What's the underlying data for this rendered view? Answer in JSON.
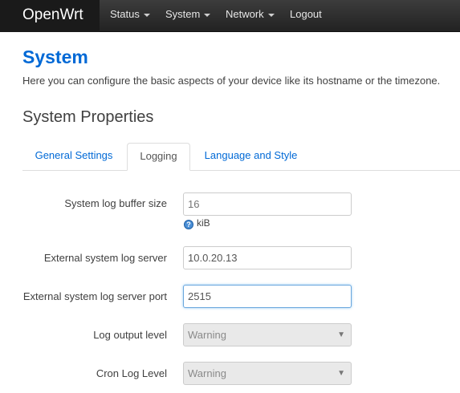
{
  "navbar": {
    "brand": "OpenWrt",
    "items": [
      {
        "label": "Status",
        "dropdown": true
      },
      {
        "label": "System",
        "dropdown": true
      },
      {
        "label": "Network",
        "dropdown": true
      },
      {
        "label": "Logout",
        "dropdown": false
      }
    ]
  },
  "page": {
    "title": "System",
    "description": "Here you can configure the basic aspects of your device like its hostname or the timezone.",
    "section_title": "System Properties"
  },
  "tabs": [
    {
      "label": "General Settings",
      "active": false
    },
    {
      "label": "Logging",
      "active": true
    },
    {
      "label": "Language and Style",
      "active": false
    }
  ],
  "form": {
    "log_buffer_size": {
      "label": "System log buffer size",
      "value": "",
      "placeholder": "16",
      "hint": "kiB"
    },
    "log_server": {
      "label": "External system log server",
      "value": "10.0.20.13"
    },
    "log_server_port": {
      "label": "External system log server port",
      "value": "2515"
    },
    "log_output_level": {
      "label": "Log output level",
      "selected": "Warning"
    },
    "cron_log_level": {
      "label": "Cron Log Level",
      "selected": "Warning"
    }
  },
  "colors": {
    "accent": "#0069d6",
    "navbar": "#222222",
    "focus_border": "#6aa7dd"
  }
}
